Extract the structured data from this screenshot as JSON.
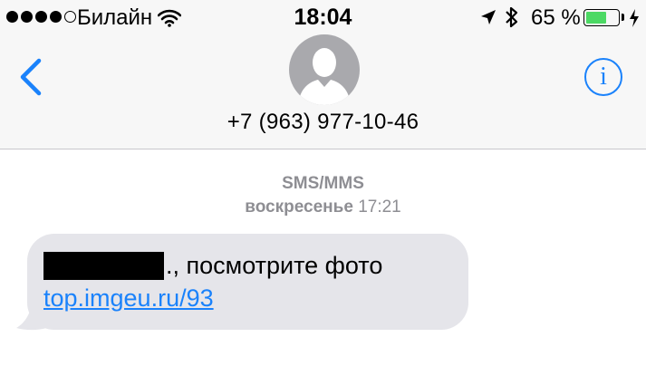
{
  "status_bar": {
    "signal_bars_filled": 4,
    "signal_bars_total": 5,
    "carrier": "Билайн",
    "wifi_icon": "wifi-icon",
    "time": "18:04",
    "location_icon": "location-arrow-icon",
    "bluetooth_icon": "bluetooth-icon",
    "battery_percent": "65 %",
    "battery_level": 0.65,
    "battery_color": "#4cd964",
    "charging_icon": "charging-bolt-icon"
  },
  "nav": {
    "back_icon": "chevron-left-icon",
    "avatar_icon": "person-silhouette-icon",
    "contact": "+7 (963) 977-10-46",
    "info_label": "i",
    "accent_color": "#1a82fb"
  },
  "conversation": {
    "service": "SMS/MMS",
    "day": "воскресенье",
    "time": "17:21",
    "message": {
      "redacted": true,
      "text_after_redaction": "., посмотрите фото",
      "link": "top.imgeu.ru/93",
      "bubble_color": "#e5e5ea"
    }
  }
}
